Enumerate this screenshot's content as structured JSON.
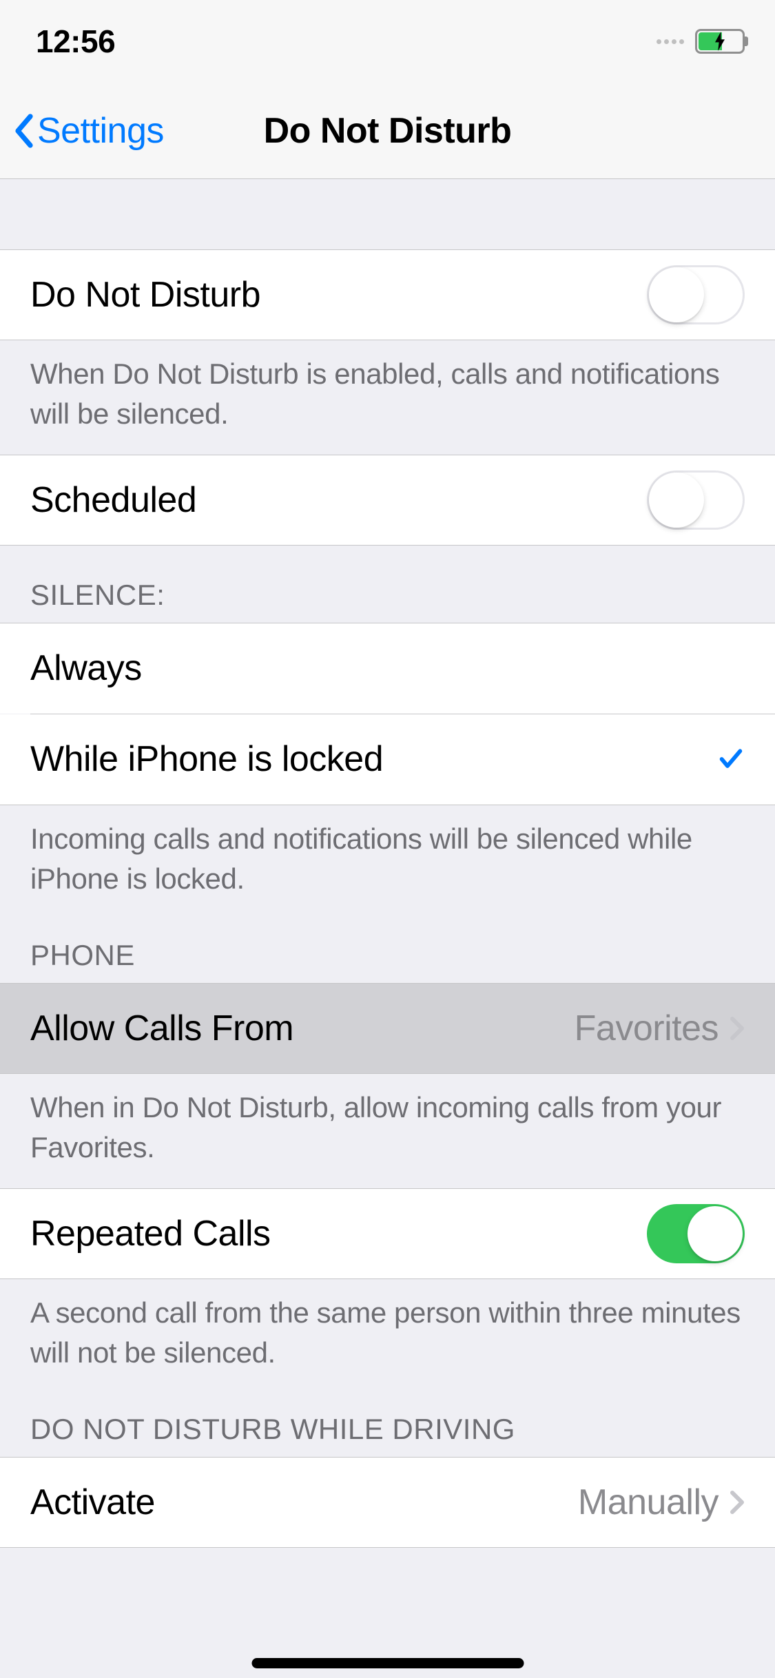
{
  "status": {
    "time": "12:56"
  },
  "nav": {
    "back": "Settings",
    "title": "Do Not Disturb"
  },
  "dnd": {
    "label": "Do Not Disturb",
    "footer": "When Do Not Disturb is enabled, calls and notifications will be silenced."
  },
  "scheduled": {
    "label": "Scheduled"
  },
  "silence": {
    "header": "SILENCE:",
    "always": "Always",
    "while_locked": "While iPhone is locked",
    "footer": "Incoming calls and notifications will be silenced while iPhone is locked."
  },
  "phone": {
    "header": "PHONE",
    "allow_calls_label": "Allow Calls From",
    "allow_calls_value": "Favorites",
    "allow_calls_footer": "When in Do Not Disturb, allow incoming calls from your Favorites.",
    "repeated_label": "Repeated Calls",
    "repeated_footer": "A second call from the same person within three minutes will not be silenced."
  },
  "driving": {
    "header": "DO NOT DISTURB WHILE DRIVING",
    "activate_label": "Activate",
    "activate_value": "Manually"
  }
}
